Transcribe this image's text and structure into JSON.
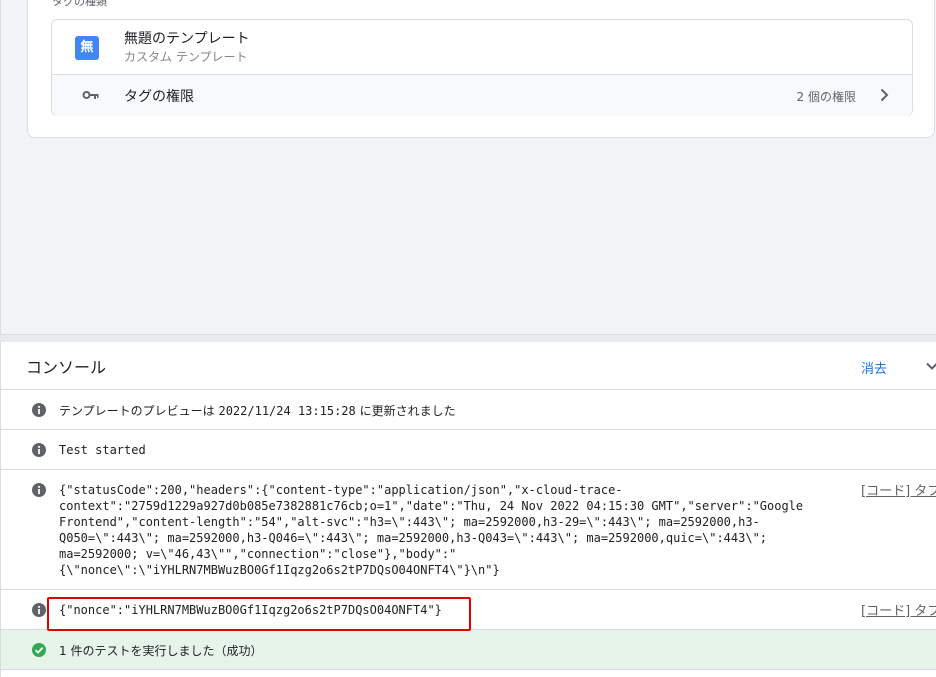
{
  "tag_section": {
    "label": "タグの種類",
    "template": {
      "icon_char": "無",
      "title": "無題のテンプレート",
      "subtitle": "カスタム テンプレート"
    },
    "permissions": {
      "label": "タグの権限",
      "count": "2 個の権限"
    }
  },
  "console": {
    "title": "コンソール",
    "clear_label": "消去",
    "logs": [
      {
        "prefix": "テンプレートのプレビューは ",
        "time": "2022/11/24 13:15:28",
        "suffix": " に更新されました"
      },
      {
        "text": "Test started"
      },
      {
        "json": "{\"statusCode\":200,\"headers\":{\"content-type\":\"application/json\",\"x-cloud-trace-\ncontext\":\"2759d1229a927d0b085e7382881c76cb;o=1\",\"date\":\"Thu, 24 Nov 2022 04:15:30 GMT\",\"server\":\"Google\nFrontend\",\"content-length\":\"54\",\"alt-svc\":\"h3=\\\":443\\\"; ma=2592000,h3-29=\\\":443\\\"; ma=2592000,h3-\nQ050=\\\":443\\\"; ma=2592000,h3-Q046=\\\":443\\\"; ma=2592000,h3-Q043=\\\":443\\\"; ma=2592000,quic=\\\":443\\\";\nma=2592000; v=\\\"46,43\\\"\",\"connection\":\"close\"},\"body\":\"\n{\\\"nonce\\\":\\\"iYHLRN7MBWuzBO0Gf1Iqzg2o6s2tP7DQsO04ONFT4\\\"}\\n\"}",
        "source": "[コード] タブ"
      },
      {
        "json": "{\"nonce\":\"iYHLRN7MBWuzBO0Gf1Iqzg2o6s2tP7DQsO04ONFT4\"}",
        "source": "[コード] タブ"
      },
      {
        "text": "1 件のテストを実行しました（成功）"
      }
    ]
  },
  "colors": {
    "accent": "#1a73e8",
    "success_bg": "#e6f4ea",
    "success_icon": "#34a853",
    "highlight": "#e00000",
    "template_icon_bg": "#4285f4"
  }
}
